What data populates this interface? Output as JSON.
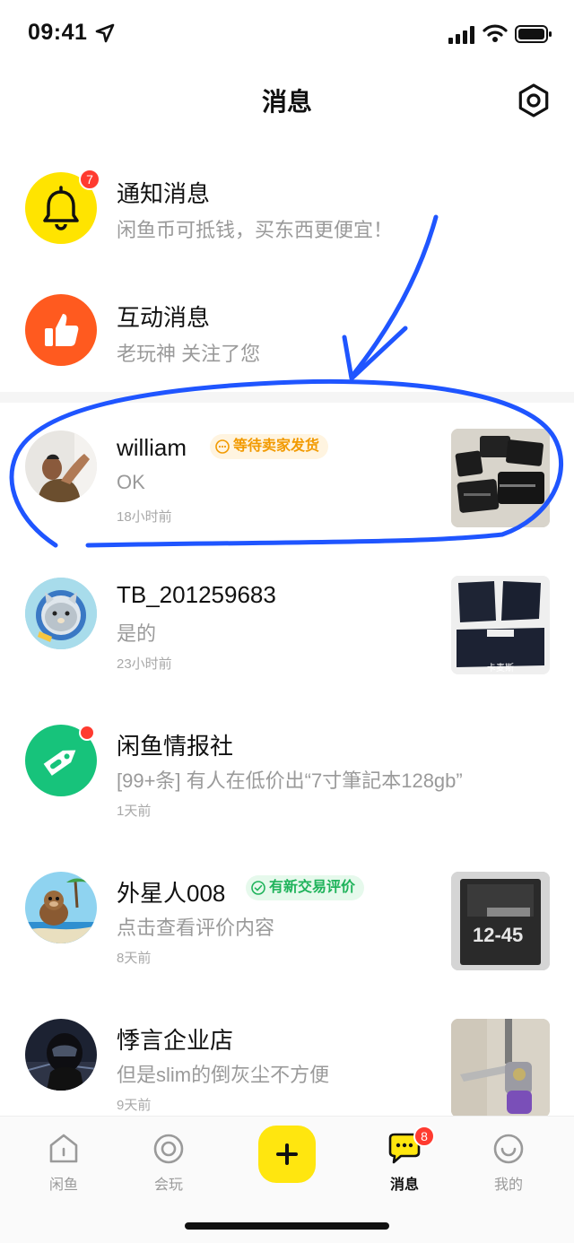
{
  "status_bar": {
    "time": "09:41"
  },
  "header": {
    "title": "消息"
  },
  "notifications": [
    {
      "title": "通知消息",
      "subtitle": "闲鱼币可抵钱，买东西更便宜！",
      "badge": "7"
    },
    {
      "title": "互动消息",
      "subtitle": "老玩神 关注了您"
    }
  ],
  "conversations": [
    {
      "name": "william",
      "tag": "等待卖家发货",
      "message": "OK",
      "time": "18小时前"
    },
    {
      "name": "TB_201259683",
      "message": "是的",
      "time": "23小时前",
      "thumb_text": "卡麦斯"
    },
    {
      "name": "闲鱼情报社",
      "message": "[99+条] 有人在低价出“7寸筆記本128gb”",
      "time": "1天前"
    },
    {
      "name": "外星人008",
      "tag": "有新交易评价",
      "message": "点击查看评价内容",
      "time": "8天前",
      "thumb_text": "12-45"
    },
    {
      "name": "悸言企业店",
      "message": "但是slim的倒灰尘不方便",
      "time": "9天前"
    }
  ],
  "tab_bar": {
    "tabs": [
      {
        "label": "闲鱼",
        "icon": "home-icon"
      },
      {
        "label": "会玩",
        "icon": "target-icon"
      },
      {
        "label": "",
        "icon": "plus-icon"
      },
      {
        "label": "消息",
        "icon": "chat-bubble-icon",
        "badge": "8",
        "active": true
      },
      {
        "label": "我的",
        "icon": "smiley-icon"
      }
    ]
  },
  "colors": {
    "brand_yellow": "#ffe60f",
    "notify_yellow": "#ffe400",
    "interact_orange": "#ff5a1f",
    "intel_green": "#17c37b",
    "badge_red": "#ff3b30",
    "annotation_blue": "#1f55ff"
  }
}
